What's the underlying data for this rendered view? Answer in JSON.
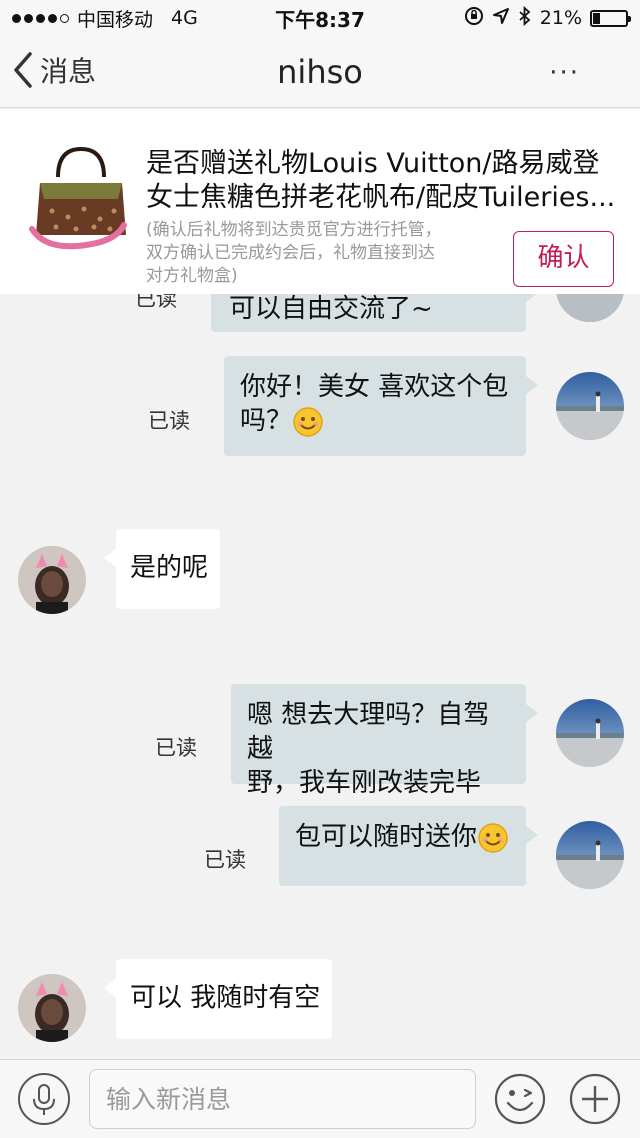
{
  "status_bar": {
    "carrier": "中国移动",
    "network": "4G",
    "time": "下午8:37",
    "battery": "21%",
    "battery_level": 0.21
  },
  "nav": {
    "back_label": "消息",
    "title": "nihso",
    "more_label": "···"
  },
  "gift_card": {
    "title_line1": "是否赠送礼物Louis Vuitton/路易威登",
    "title_line2": "女士焦糖色拼老花帆布/配皮Tuileries...",
    "note_line1": "(确认后礼物将到达贵觅官方进行托管，",
    "note_line2": "双方确认已完成约会后，礼物直接到达",
    "note_line3": "对方礼物盒)",
    "confirm_label": "确认"
  },
  "messages": [
    {
      "side": "out",
      "read": "已读",
      "text": "可以自由交流了~"
    },
    {
      "side": "out",
      "read": "已读",
      "text_line1": "你好！美女  喜欢这个包",
      "text_line2": "吗？"
    },
    {
      "side": "in",
      "text": "是的呢"
    },
    {
      "side": "out",
      "read": "已读",
      "text_line1": "嗯 想去大理吗？自驾越",
      "text_line2": "野，我车刚改装完毕"
    },
    {
      "side": "out",
      "read": "已读",
      "text": "包可以随时送你"
    },
    {
      "side": "in",
      "text": "可以 我随时有空"
    }
  ],
  "input_bar": {
    "placeholder": "输入新消息"
  }
}
